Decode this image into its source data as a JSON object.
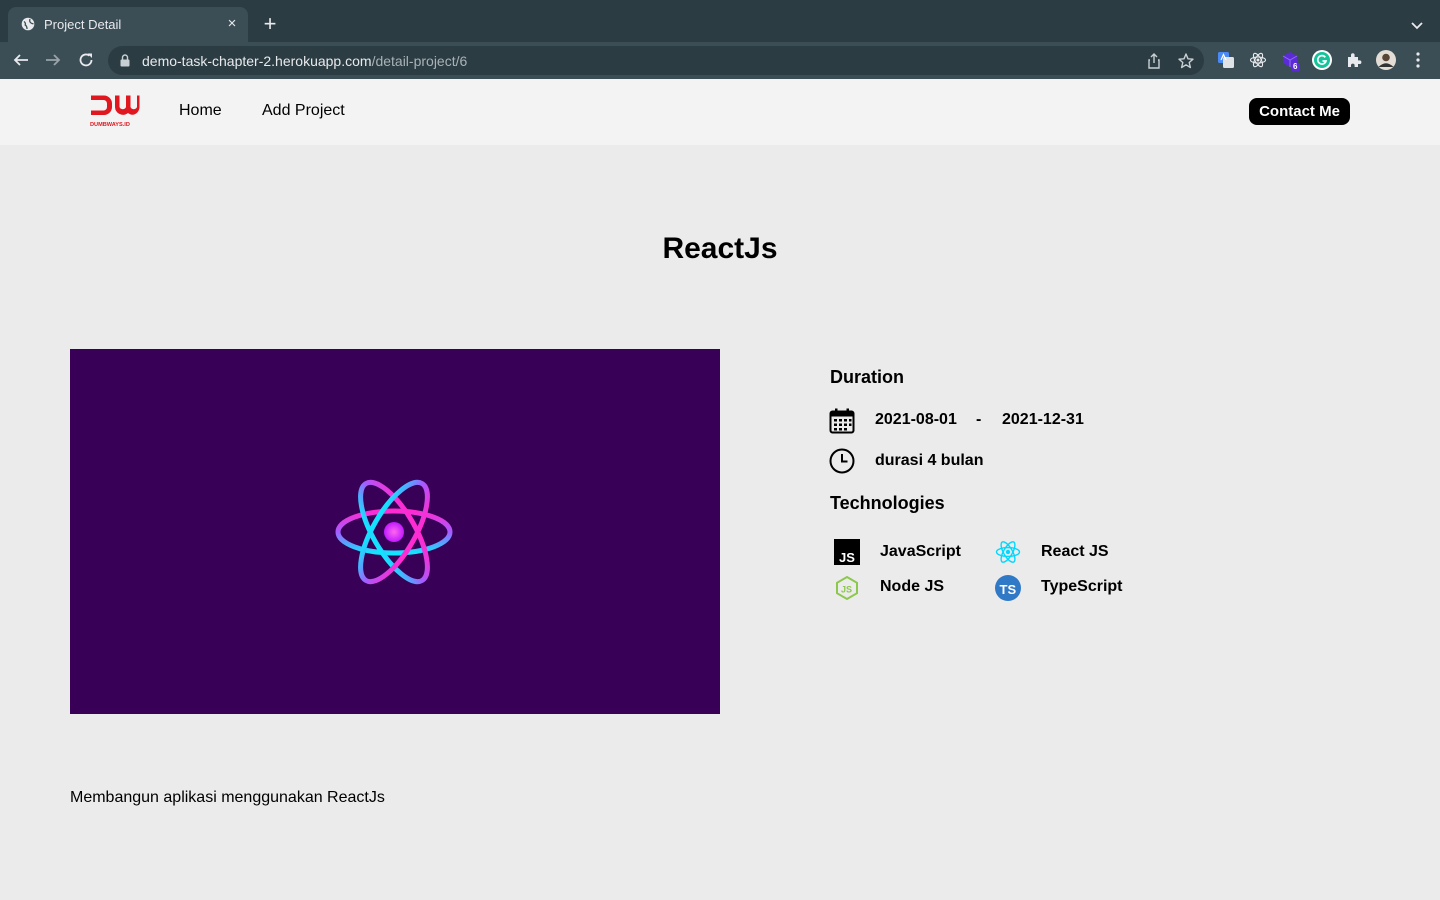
{
  "browser": {
    "tab_title": "Project Detail",
    "tab_close": "×",
    "new_tab": "+",
    "url_host": "demo-task-chapter-2.herokuapp.com",
    "url_path": "/detail-project/6",
    "extension_badge": "6",
    "icons": [
      "globe-icon",
      "search-tabs-icon",
      "back-arrow-icon",
      "forward-arrow-icon",
      "reload-icon",
      "lock-icon",
      "share-icon",
      "bookmark-star-icon",
      "translate-extension-icon",
      "react-devtools-icon",
      "extension-cube-icon",
      "grammarly-icon",
      "puzzle-extensions-icon",
      "profile-avatar-icon",
      "kebab-menu-icon"
    ]
  },
  "navbar": {
    "logo_letters": "DW",
    "logo_sub": "DUMBWAYS.ID",
    "home": "Home",
    "add_project": "Add Project",
    "contact": "Contact Me"
  },
  "project": {
    "title": "ReactJs",
    "image_bg": "#380056",
    "duration_heading": "Duration",
    "start_date": "2021-08-01",
    "date_separator": "-",
    "end_date": "2021-12-31",
    "duration_text": "durasi 4 bulan",
    "tech_heading": "Technologies",
    "technologies": [
      {
        "name": "JavaScript",
        "icon": "javascript-icon"
      },
      {
        "name": "React JS",
        "icon": "react-icon"
      },
      {
        "name": "Node JS",
        "icon": "nodejs-icon"
      },
      {
        "name": "TypeScript",
        "icon": "typescript-icon"
      }
    ],
    "description": "Membangun aplikasi menggunakan ReactJs"
  },
  "colors": {
    "brand_red": "#e0171f",
    "chrome_dark": "#2c3c43",
    "chrome_mid": "#3b4d55",
    "page_bg": "#ebebeb",
    "navbar_bg": "#f3f3f3"
  }
}
